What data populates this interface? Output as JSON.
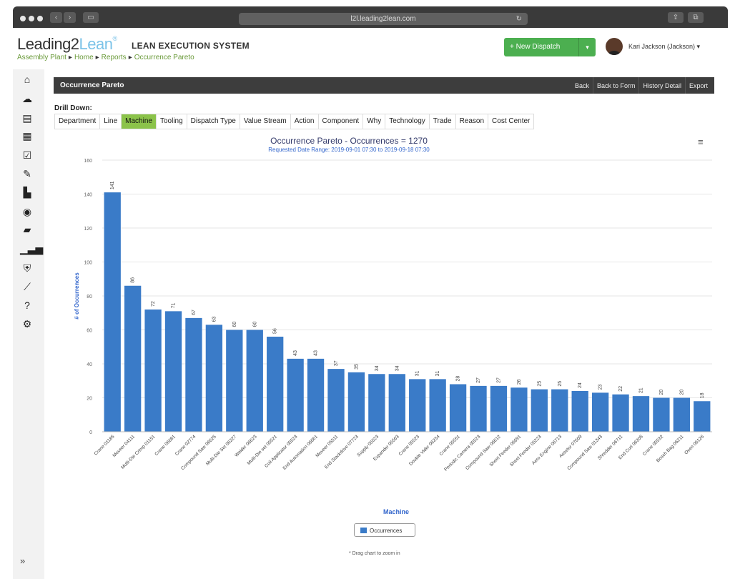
{
  "browser": {
    "url": "l2l.leading2lean.com"
  },
  "header": {
    "logo_main": "Leading2",
    "logo_lean": "Lean",
    "logo_tm": "®",
    "system_name": "LEAN EXECUTION SYSTEM",
    "breadcrumbs": [
      "Assembly Plant",
      "Home",
      "Reports",
      "Occurrence Pareto"
    ],
    "dispatch_label": "+ New Dispatch",
    "user_name": "Kari Jackson (Jackson) ▾"
  },
  "sidebar": {
    "icons": [
      "home-icon",
      "cloud-icon",
      "document-icon",
      "calendar-icon",
      "clipboard-check-icon",
      "wrench-icon",
      "factory-icon",
      "dashboard-gauge-icon",
      "graduation-cap-icon",
      "signal-bars-icon",
      "shield-check-icon",
      "line-chart-icon",
      "help-icon",
      "gear-icon"
    ],
    "icon_glyphs": [
      "⌂",
      "☁",
      "▤",
      "▦",
      "☑",
      "✎",
      "▙",
      "◉",
      "▰",
      "▁▃▅",
      "⛨",
      "⟋",
      "?",
      "⚙"
    ],
    "expand_glyph": "»"
  },
  "panel": {
    "title": "Occurrence Pareto",
    "links": [
      "Back",
      "Back to Form",
      "History Detail",
      "Export"
    ]
  },
  "drill": {
    "label": "Drill Down:",
    "tabs": [
      "Department",
      "Line",
      "Machine",
      "Tooling",
      "Dispatch Type",
      "Value Stream",
      "Action",
      "Component",
      "Why",
      "Technology",
      "Trade",
      "Reason",
      "Cost Center"
    ],
    "active": "Machine"
  },
  "chart": {
    "menu_glyph": "≡",
    "hint": "* Drag chart to zoom in"
  },
  "chart_data": {
    "type": "bar",
    "title": "Occurrence Pareto - Occurrences = 1270",
    "subtitle": "Requested Date Range: 2019-09-01 07:30 to 2019-09-18 07:30",
    "xlabel": "Machine",
    "ylabel": "# of Occurrences",
    "ylim": [
      0,
      160
    ],
    "yticks": [
      0,
      20,
      40,
      60,
      80,
      100,
      120,
      140,
      160
    ],
    "grid": true,
    "legend": "bottom-center",
    "series": [
      {
        "name": "Occurrences",
        "color": "#3a7bc8",
        "values": [
          141,
          86,
          72,
          71,
          67,
          63,
          60,
          60,
          56,
          43,
          43,
          37,
          35,
          34,
          34,
          31,
          31,
          28,
          27,
          27,
          26,
          25,
          25,
          24,
          23,
          22,
          21,
          20,
          20,
          18
        ]
      }
    ],
    "categories": [
      "Crane 01185",
      "Moveer 04111",
      "Multi-Die Crimp 01151",
      "Crane 06681",
      "Crane 02774",
      "Compound Saw 06625",
      "Multi-Die Set 06227",
      "Welder 06623",
      "Multi-Die set 05521",
      "Coil Applicator 05523",
      "End Automation 06661",
      "Moveer 05511",
      "End Stackdrive 07723",
      "Supply 05523",
      "Expander 05563",
      "Crane 05523",
      "Double Vider 06234",
      "Crane 05551",
      "Periodic Camera 05523",
      "Compound Saw 06612",
      "Sheet Feeder 06691",
      "Sheet Feeder 05223",
      "Aero Engine 06713",
      "Assetor 07609",
      "Compound Saw 01343",
      "Shredder 06711",
      "End Curl 06205",
      "Crane 05532",
      "Bosch Bag 06211",
      "Oven 06126"
    ]
  }
}
